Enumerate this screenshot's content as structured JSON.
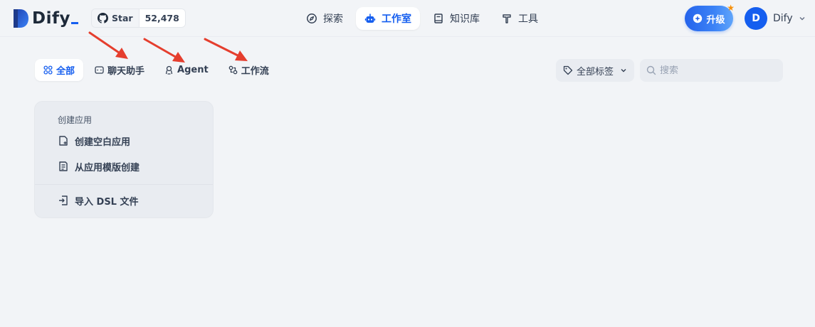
{
  "app": {
    "logo_text": "Dify",
    "github": {
      "star_label": "Star",
      "star_count": "52,478"
    }
  },
  "nav": {
    "items": [
      {
        "label": "探索",
        "icon": "compass-icon"
      },
      {
        "label": "工作室",
        "icon": "robot-icon",
        "active": true
      },
      {
        "label": "知识库",
        "icon": "book-icon"
      },
      {
        "label": "工具",
        "icon": "hammer-icon"
      }
    ]
  },
  "header": {
    "upgrade_label": "升级",
    "user": {
      "avatar_initial": "D",
      "name": "Dify"
    }
  },
  "tabs": [
    {
      "label": "全部",
      "icon": "grid-icon",
      "active": true
    },
    {
      "label": "聊天助手",
      "icon": "chat-icon"
    },
    {
      "label": "Agent",
      "icon": "agent-icon"
    },
    {
      "label": "工作流",
      "icon": "workflow-icon"
    }
  ],
  "filters": {
    "tag_label": "全部标签",
    "search_placeholder": "搜索"
  },
  "create_card": {
    "title": "创建应用",
    "items": [
      {
        "label": "创建空白应用",
        "icon": "blank-file-icon"
      },
      {
        "label": "从应用模版创建",
        "icon": "template-icon"
      },
      {
        "label": "导入 DSL 文件",
        "icon": "import-icon"
      }
    ]
  },
  "colors": {
    "accent": "#155eef",
    "background": "#f2f4f7",
    "annotation_arrow": "#e53e2e"
  }
}
